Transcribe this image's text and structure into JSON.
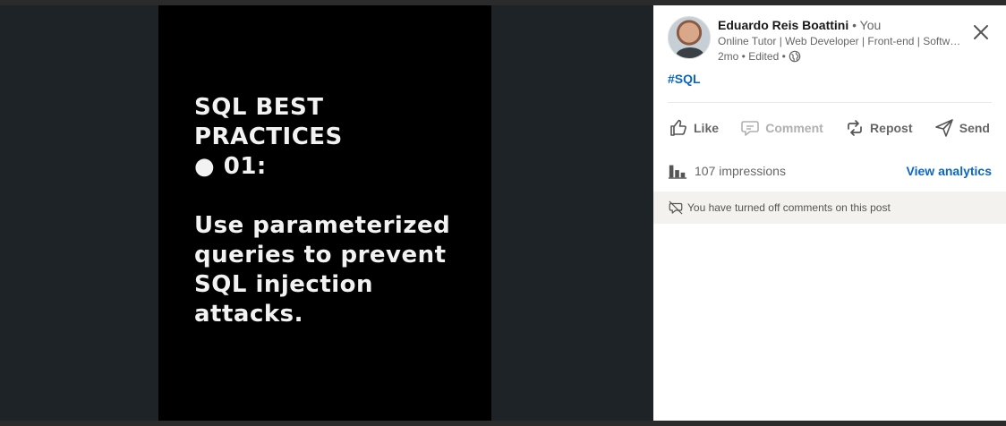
{
  "slide": {
    "lines": [
      "SQL BEST",
      "PRACTICES",
      "● 01:",
      "",
      "Use parameterized",
      "queries to prevent",
      "SQL injection",
      "attacks."
    ]
  },
  "post": {
    "author_name": "Eduardo Reis Boattini",
    "author_you": " • You",
    "headline": "Online Tutor | Web Developer | Front-end | Software Engineer",
    "meta": "2mo • Edited •",
    "hashtag": "#SQL"
  },
  "actions": {
    "like": "Like",
    "comment": "Comment",
    "repost": "Repost",
    "send": "Send"
  },
  "analytics": {
    "impressions": "107 impressions",
    "view_label": "View analytics"
  },
  "notice": {
    "comments_off": "You have turned off comments on this post"
  },
  "colors": {
    "accent": "#0a66c2",
    "slide_bg": "#000000",
    "media_bg": "#1e2328"
  }
}
